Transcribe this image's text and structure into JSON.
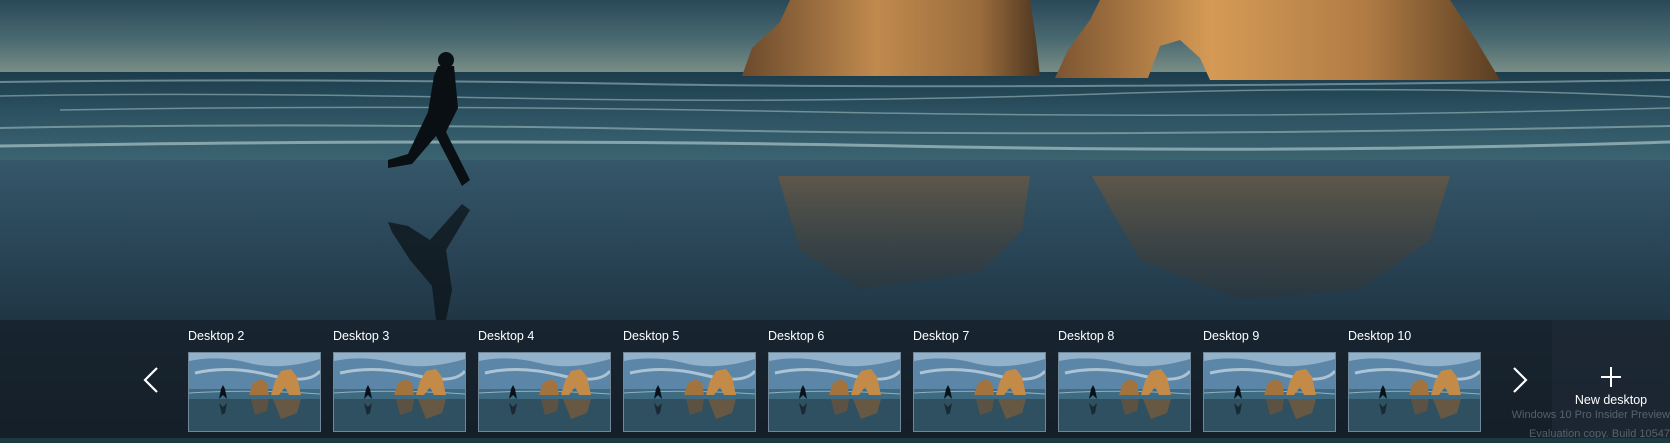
{
  "task_view": {
    "desktops": [
      {
        "label": "Desktop 2"
      },
      {
        "label": "Desktop 3"
      },
      {
        "label": "Desktop 4"
      },
      {
        "label": "Desktop 5"
      },
      {
        "label": "Desktop 6"
      },
      {
        "label": "Desktop 7"
      },
      {
        "label": "Desktop 8"
      },
      {
        "label": "Desktop 9"
      },
      {
        "label": "Desktop 10"
      }
    ],
    "prev_icon": "chevron-left-icon",
    "next_icon": "chevron-right-icon",
    "new_desktop": {
      "icon": "plus-icon",
      "label": "New desktop"
    }
  },
  "watermark": {
    "line1": "Windows 10 Pro Insider Preview",
    "line2": "Evaluation copy. Build 10547"
  },
  "colors": {
    "strip_background": "#16202a",
    "thumbnail_border": "#6f8796",
    "text": "#ffffff"
  }
}
